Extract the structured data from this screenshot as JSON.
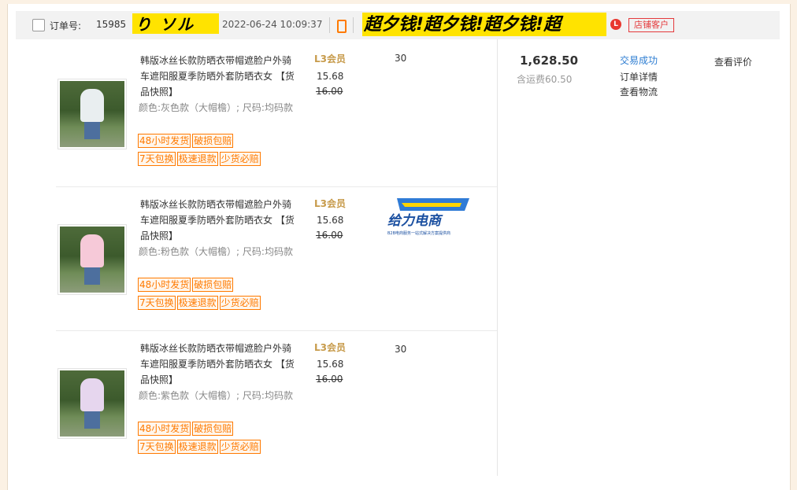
{
  "order": {
    "label": "订单号:",
    "number": "15985",
    "scribble1": "り ソル ",
    "date": "2022-06-24 10:09:37",
    "scribble2": "超夕钱!超夕钱!超夕钱!超",
    "shop_icon": "L",
    "badge": "店铺客户"
  },
  "items": [
    {
      "title": "韩版冰丝长款防晒衣带帽遮脸户外骑车遮阳服夏季防晒外套防晒衣女 【货品快照】",
      "attrs": "颜色:灰色款（大帽檐）; 尺码:均码款",
      "tags": [
        "48小时发货",
        "破损包赔",
        "7天包换",
        "极速退款",
        "少货必赔"
      ],
      "member": "L3会员",
      "price": "15.68",
      "original_price": "16.00",
      "qty": "30",
      "coat_color": "#e9eef0"
    },
    {
      "title": "韩版冰丝长款防晒衣带帽遮脸户外骑车遮阳服夏季防晒外套防晒衣女 【货品快照】",
      "attrs": "颜色:粉色款（大帽檐）; 尺码:均码款",
      "tags": [
        "48小时发货",
        "破损包赔",
        "7天包换",
        "极速退款",
        "少货必赔"
      ],
      "member": "L3会员",
      "price": "15.68",
      "original_price": "16.00",
      "qty": "",
      "coat_color": "#f6c9d8"
    },
    {
      "title": "韩版冰丝长款防晒衣带帽遮脸户外骑车遮阳服夏季防晒外套防晒衣女 【货品快照】",
      "attrs": "颜色:紫色款（大帽檐）; 尺码:均码款",
      "tags": [
        "48小时发货",
        "破损包赔",
        "7天包换",
        "极速退款",
        "少货必赔"
      ],
      "member": "L3会员",
      "price": "15.68",
      "original_price": "16.00",
      "qty": "30",
      "coat_color": "#e6d6ee"
    }
  ],
  "summary": {
    "total": "1,628.50",
    "shipping": "含运费60.50",
    "status": "交易成功",
    "detail": "订单详情",
    "logistics": "查看物流",
    "review": "查看评价"
  },
  "watermark": {
    "brand": "给力电商",
    "sub": "B2B电商服务一站式解决方案提供商"
  }
}
